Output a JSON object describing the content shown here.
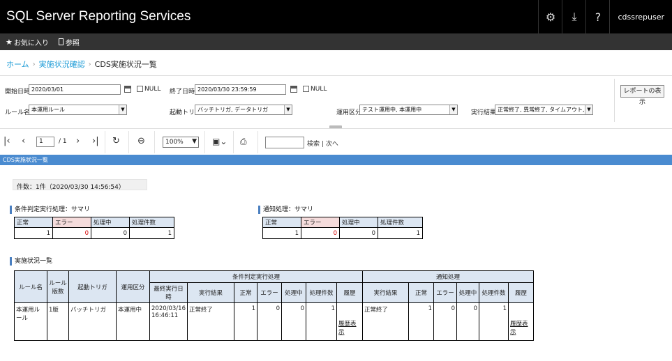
{
  "app": {
    "title": "SQL Server Reporting Services",
    "user": "cdssrepuser",
    "icons": [
      "gear-icon",
      "download-icon",
      "help-icon"
    ]
  },
  "favbar": {
    "favorites": "お気に入り",
    "browse": "参照"
  },
  "breadcrumb": {
    "home": "ホーム",
    "status": "実施状況確認",
    "current": "CDS実施状況一覧"
  },
  "params": {
    "start_label": "開始日時",
    "start_value": "2020/03/01",
    "start_null": "NULL",
    "end_label": "終了日時",
    "end_value": "2020/03/30 23:59:59",
    "end_null": "NULL",
    "rule_label": "ルール名",
    "rule_value": "本運用ルール",
    "trigger_label": "起動トリガ",
    "trigger_value": "バッチトリガ, データトリガ",
    "mode_label": "運用区分",
    "mode_value": "テスト運用中, 本運用中",
    "result_label": "実行結果",
    "result_value": "正常終了, 異常終了, タイムアウト, デー",
    "view_report": "レポートの表示"
  },
  "toolbar": {
    "page_value": "1",
    "page_of": "/ 1",
    "zoom": "100%",
    "find_label": "検索",
    "find_sep": "|",
    "next_label": "次へ"
  },
  "report": {
    "header": "CDS実施状況一覧",
    "count": "件数：1件（2020/03/30 14:56:54）",
    "cond_summary": {
      "title": "条件判定実行処理：サマリ",
      "headers": [
        "正常",
        "エラー",
        "処理中",
        "処理件数"
      ],
      "values": [
        "1",
        "0",
        "0",
        "1"
      ]
    },
    "notify_summary": {
      "title": "通知処理：サマリ",
      "headers": [
        "正常",
        "エラー",
        "処理中",
        "処理件数"
      ],
      "values": [
        "1",
        "0",
        "0",
        "1"
      ]
    },
    "status": {
      "title": "実施状況一覧",
      "col_rule": "ルール名",
      "col_version": "ルール版数",
      "col_trigger": "起動トリガ",
      "col_mode": "運用区分",
      "group_cond": "条件判定実行処理",
      "group_notify": "通知処理",
      "cond_cols": [
        "最終実行日時",
        "実行結果",
        "正常",
        "エラー",
        "処理中",
        "処理件数",
        "履歴"
      ],
      "notify_cols": [
        "実行結果",
        "正常",
        "エラー",
        "処理中",
        "処理件数",
        "履歴"
      ],
      "row": {
        "rule": "本運用ルール",
        "version": "1版",
        "trigger": "バッチトリガ",
        "mode": "本運用中",
        "cond_last": "2020/03/16 16:46:11",
        "cond_result": "正常終了",
        "cond_ok": "1",
        "cond_err": "0",
        "cond_proc": "0",
        "cond_count": "1",
        "cond_hist": "履歴表示",
        "notify_result": "正常終了",
        "notify_ok": "1",
        "notify_err": "0",
        "notify_proc": "0",
        "notify_count": "1",
        "notify_hist": "履歴表示"
      }
    }
  },
  "colors": {
    "accent": "#4a8bd0",
    "link": "#1a9ad6",
    "error": "#d40000",
    "header_bg": "#dce6f2"
  }
}
